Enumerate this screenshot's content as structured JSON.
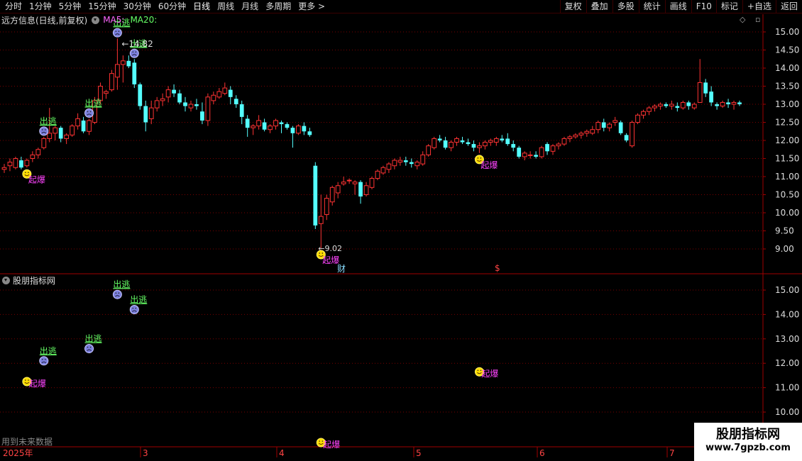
{
  "toolbar": {
    "periods": [
      "分时",
      "1分钟",
      "5分钟",
      "15分钟",
      "30分钟",
      "60分钟",
      "日线",
      "周线",
      "月线",
      "多周期",
      "更多 >"
    ],
    "active": "日线",
    "buttons": [
      "复权",
      "叠加",
      "多股",
      "统计",
      "画线",
      "F10",
      "标记",
      "+自选",
      "返回"
    ]
  },
  "main": {
    "stock_title": "远方信息(日线,前复权)",
    "ma5_label": "MA5:",
    "ma20_label": "MA20:",
    "high_label": "14.82",
    "low_label": "9.02",
    "fin_mark": "财",
    "dollar_mark": "$"
  },
  "sub": {
    "title": "股朋指标网",
    "future_note": "用到未来数据"
  },
  "signals": {
    "escape": "出逃",
    "boom": "起爆"
  },
  "date_axis": {
    "year": "2025年",
    "months": [
      "3",
      "4",
      "5",
      "6",
      "7"
    ]
  },
  "watermark": {
    "line1": "股朋指标网",
    "line2": "www.7gpzb.com"
  },
  "colors": {
    "up": "#ff3333",
    "down": "#54ffff",
    "grid": "#7a0000",
    "axis_text": "#dddddd",
    "escape": "#66ff66",
    "boom": "#ff44ff"
  },
  "chart_data": {
    "type": "candlestick",
    "main_axis": {
      "min": 9.0,
      "max": 15.0,
      "ticks": [
        "15.00",
        "14.50",
        "14.00",
        "13.50",
        "13.00",
        "12.50",
        "12.00",
        "11.50",
        "11.00",
        "10.50",
        "10.00",
        "9.50",
        "9.00"
      ]
    },
    "sub_axis": {
      "min": 10.0,
      "max": 15.0,
      "ticks": [
        "15.00",
        "14.00",
        "13.00",
        "12.00",
        "11.00",
        "10.00"
      ]
    },
    "candles": [
      [
        11.2,
        11.35,
        11.1,
        11.25
      ],
      [
        11.3,
        11.5,
        11.15,
        11.4
      ],
      [
        11.25,
        11.55,
        11.2,
        11.5
      ],
      [
        11.45,
        11.55,
        11.2,
        11.25
      ],
      [
        11.3,
        11.5,
        11.25,
        11.45
      ],
      [
        11.5,
        11.7,
        11.4,
        11.6
      ],
      [
        11.6,
        11.8,
        11.5,
        11.75
      ],
      [
        11.8,
        12.1,
        11.75,
        12.05
      ],
      [
        12.05,
        12.9,
        11.95,
        12.2
      ],
      [
        12.2,
        12.4,
        12.0,
        12.35
      ],
      [
        12.35,
        12.4,
        11.95,
        12.05
      ],
      [
        12.05,
        12.2,
        11.9,
        12.15
      ],
      [
        12.15,
        12.45,
        12.1,
        12.4
      ],
      [
        12.4,
        12.75,
        12.3,
        12.6
      ],
      [
        12.55,
        12.65,
        12.2,
        12.25
      ],
      [
        12.25,
        12.6,
        12.15,
        12.55
      ],
      [
        12.5,
        13.2,
        12.45,
        13.1
      ],
      [
        13.1,
        13.6,
        13.0,
        13.5
      ],
      [
        13.3,
        13.4,
        13.15,
        13.35
      ],
      [
        13.4,
        13.95,
        13.35,
        13.85
      ],
      [
        13.75,
        14.82,
        13.4,
        14.1
      ],
      [
        14.1,
        14.35,
        13.6,
        14.2
      ],
      [
        14.2,
        14.35,
        14.0,
        14.05
      ],
      [
        14.15,
        14.25,
        13.45,
        13.55
      ],
      [
        13.55,
        13.6,
        12.85,
        12.95
      ],
      [
        12.95,
        13.1,
        12.25,
        12.5
      ],
      [
        12.6,
        13.1,
        12.45,
        12.9
      ],
      [
        12.9,
        13.2,
        12.8,
        13.1
      ],
      [
        13.1,
        13.3,
        12.95,
        13.15
      ],
      [
        13.2,
        13.5,
        13.05,
        13.4
      ],
      [
        13.4,
        13.55,
        13.2,
        13.3
      ],
      [
        13.3,
        13.4,
        13.0,
        13.05
      ],
      [
        13.05,
        13.2,
        12.8,
        12.95
      ],
      [
        12.9,
        13.1,
        12.8,
        13.0
      ],
      [
        13.0,
        13.15,
        12.85,
        12.95
      ],
      [
        12.8,
        13.05,
        12.45,
        12.55
      ],
      [
        12.55,
        13.3,
        12.4,
        13.2
      ],
      [
        13.1,
        13.35,
        13.0,
        13.25
      ],
      [
        13.2,
        13.45,
        13.15,
        13.35
      ],
      [
        13.3,
        13.6,
        13.25,
        13.45
      ],
      [
        13.4,
        13.5,
        13.0,
        13.2
      ],
      [
        13.15,
        13.25,
        12.9,
        13.0
      ],
      [
        13.0,
        13.1,
        12.45,
        12.65
      ],
      [
        12.6,
        12.7,
        12.1,
        12.35
      ],
      [
        12.35,
        12.45,
        12.15,
        12.4
      ],
      [
        12.4,
        12.7,
        12.3,
        12.55
      ],
      [
        12.5,
        12.6,
        12.25,
        12.3
      ],
      [
        12.3,
        12.45,
        12.2,
        12.4
      ],
      [
        12.4,
        12.6,
        12.3,
        12.55
      ],
      [
        12.5,
        12.55,
        12.2,
        12.45
      ],
      [
        12.45,
        12.5,
        12.3,
        12.35
      ],
      [
        12.35,
        12.4,
        11.8,
        12.2
      ],
      [
        12.2,
        12.45,
        12.15,
        12.4
      ],
      [
        12.4,
        12.5,
        12.15,
        12.25
      ],
      [
        12.25,
        12.35,
        12.1,
        12.15
      ],
      [
        11.3,
        11.4,
        9.55,
        9.65
      ],
      [
        9.7,
        10.5,
        9.02,
        9.9
      ],
      [
        9.95,
        10.5,
        9.8,
        10.4
      ],
      [
        10.3,
        10.75,
        10.2,
        10.7
      ],
      [
        10.55,
        10.85,
        10.4,
        10.75
      ],
      [
        10.8,
        11.0,
        10.75,
        10.85
      ],
      [
        10.9,
        10.95,
        10.8,
        10.9
      ],
      [
        10.8,
        10.9,
        10.5,
        10.85
      ],
      [
        10.85,
        10.9,
        10.25,
        10.45
      ],
      [
        10.5,
        10.85,
        10.45,
        10.75
      ],
      [
        10.7,
        11.0,
        10.65,
        10.95
      ],
      [
        10.95,
        11.2,
        10.9,
        11.15
      ],
      [
        11.1,
        11.3,
        11.05,
        11.25
      ],
      [
        11.2,
        11.4,
        11.1,
        11.35
      ],
      [
        11.3,
        11.5,
        11.2,
        11.45
      ],
      [
        11.4,
        11.55,
        11.3,
        11.45
      ],
      [
        11.45,
        11.55,
        11.3,
        11.4
      ],
      [
        11.4,
        11.5,
        11.25,
        11.35
      ],
      [
        11.3,
        11.45,
        11.2,
        11.4
      ],
      [
        11.35,
        11.7,
        11.3,
        11.6
      ],
      [
        11.6,
        11.9,
        11.55,
        11.85
      ],
      [
        11.8,
        12.1,
        11.75,
        12.05
      ],
      [
        12.05,
        12.15,
        11.95,
        12.0
      ],
      [
        12.0,
        12.1,
        11.75,
        11.8
      ],
      [
        11.8,
        12.0,
        11.7,
        11.95
      ],
      [
        11.95,
        12.1,
        11.85,
        12.05
      ],
      [
        12.0,
        12.1,
        11.9,
        11.95
      ],
      [
        11.95,
        12.05,
        11.85,
        11.9
      ],
      [
        11.9,
        12.0,
        11.7,
        11.8
      ],
      [
        11.8,
        11.95,
        11.65,
        11.85
      ],
      [
        11.85,
        12.0,
        11.75,
        11.95
      ],
      [
        11.95,
        12.05,
        11.85,
        12.0
      ],
      [
        11.95,
        12.1,
        11.85,
        12.05
      ],
      [
        12.05,
        12.15,
        11.95,
        12.0
      ],
      [
        12.05,
        12.2,
        11.85,
        11.9
      ],
      [
        11.9,
        12.0,
        11.7,
        11.8
      ],
      [
        11.8,
        11.85,
        11.5,
        11.55
      ],
      [
        11.55,
        11.7,
        11.45,
        11.65
      ],
      [
        11.6,
        11.7,
        11.5,
        11.6
      ],
      [
        11.6,
        11.7,
        11.5,
        11.55
      ],
      [
        11.55,
        11.85,
        11.5,
        11.8
      ],
      [
        11.9,
        11.95,
        11.6,
        11.7
      ],
      [
        11.7,
        11.9,
        11.6,
        11.85
      ],
      [
        11.85,
        11.95,
        11.75,
        11.9
      ],
      [
        11.9,
        12.1,
        11.85,
        12.05
      ],
      [
        12.05,
        12.15,
        11.95,
        12.1
      ],
      [
        12.1,
        12.2,
        12.05,
        12.15
      ],
      [
        12.15,
        12.25,
        12.05,
        12.2
      ],
      [
        12.2,
        12.3,
        12.1,
        12.25
      ],
      [
        12.2,
        12.4,
        12.15,
        12.3
      ],
      [
        12.3,
        12.55,
        12.2,
        12.5
      ],
      [
        12.5,
        12.6,
        12.25,
        12.35
      ],
      [
        12.35,
        12.5,
        12.25,
        12.45
      ],
      [
        12.5,
        12.65,
        12.4,
        12.55
      ],
      [
        12.5,
        12.55,
        12.15,
        12.2
      ],
      [
        12.15,
        12.2,
        11.95,
        12.0
      ],
      [
        11.85,
        12.55,
        11.8,
        12.5
      ],
      [
        12.5,
        12.75,
        12.45,
        12.7
      ],
      [
        12.7,
        12.85,
        12.6,
        12.8
      ],
      [
        12.8,
        12.95,
        12.7,
        12.9
      ],
      [
        12.9,
        13.0,
        12.8,
        12.95
      ],
      [
        12.95,
        13.05,
        12.85,
        13.0
      ],
      [
        13.0,
        13.05,
        12.9,
        12.95
      ],
      [
        12.95,
        13.1,
        12.85,
        13.0
      ],
      [
        12.95,
        13.05,
        12.8,
        12.9
      ],
      [
        12.9,
        13.1,
        12.85,
        13.05
      ],
      [
        13.05,
        13.1,
        12.85,
        12.95
      ],
      [
        12.9,
        13.05,
        12.85,
        13.0
      ],
      [
        13.05,
        14.25,
        13.5,
        13.6
      ],
      [
        13.6,
        13.7,
        13.2,
        13.3
      ],
      [
        13.35,
        13.5,
        12.95,
        13.05
      ],
      [
        13.0,
        13.05,
        12.85,
        12.95
      ],
      [
        12.95,
        13.1,
        12.9,
        13.05
      ],
      [
        13.05,
        13.15,
        12.9,
        13.0
      ],
      [
        13.0,
        13.1,
        12.85,
        13.05
      ],
      [
        13.05,
        13.1,
        12.95,
        13.0
      ]
    ],
    "escape_signals": [
      {
        "label": "出逃",
        "price": 14.82
      },
      {
        "label": "出逃",
        "price": 12.1
      },
      {
        "label": "出逃",
        "price": 12.6
      },
      {
        "label": "出逃",
        "price": 14.2
      }
    ],
    "boom_signals": [
      {
        "label": "起爆",
        "price": 9.02
      },
      {
        "label": "起爆",
        "price": 11.25
      },
      {
        "label": "起爆",
        "price": 11.65
      }
    ]
  }
}
